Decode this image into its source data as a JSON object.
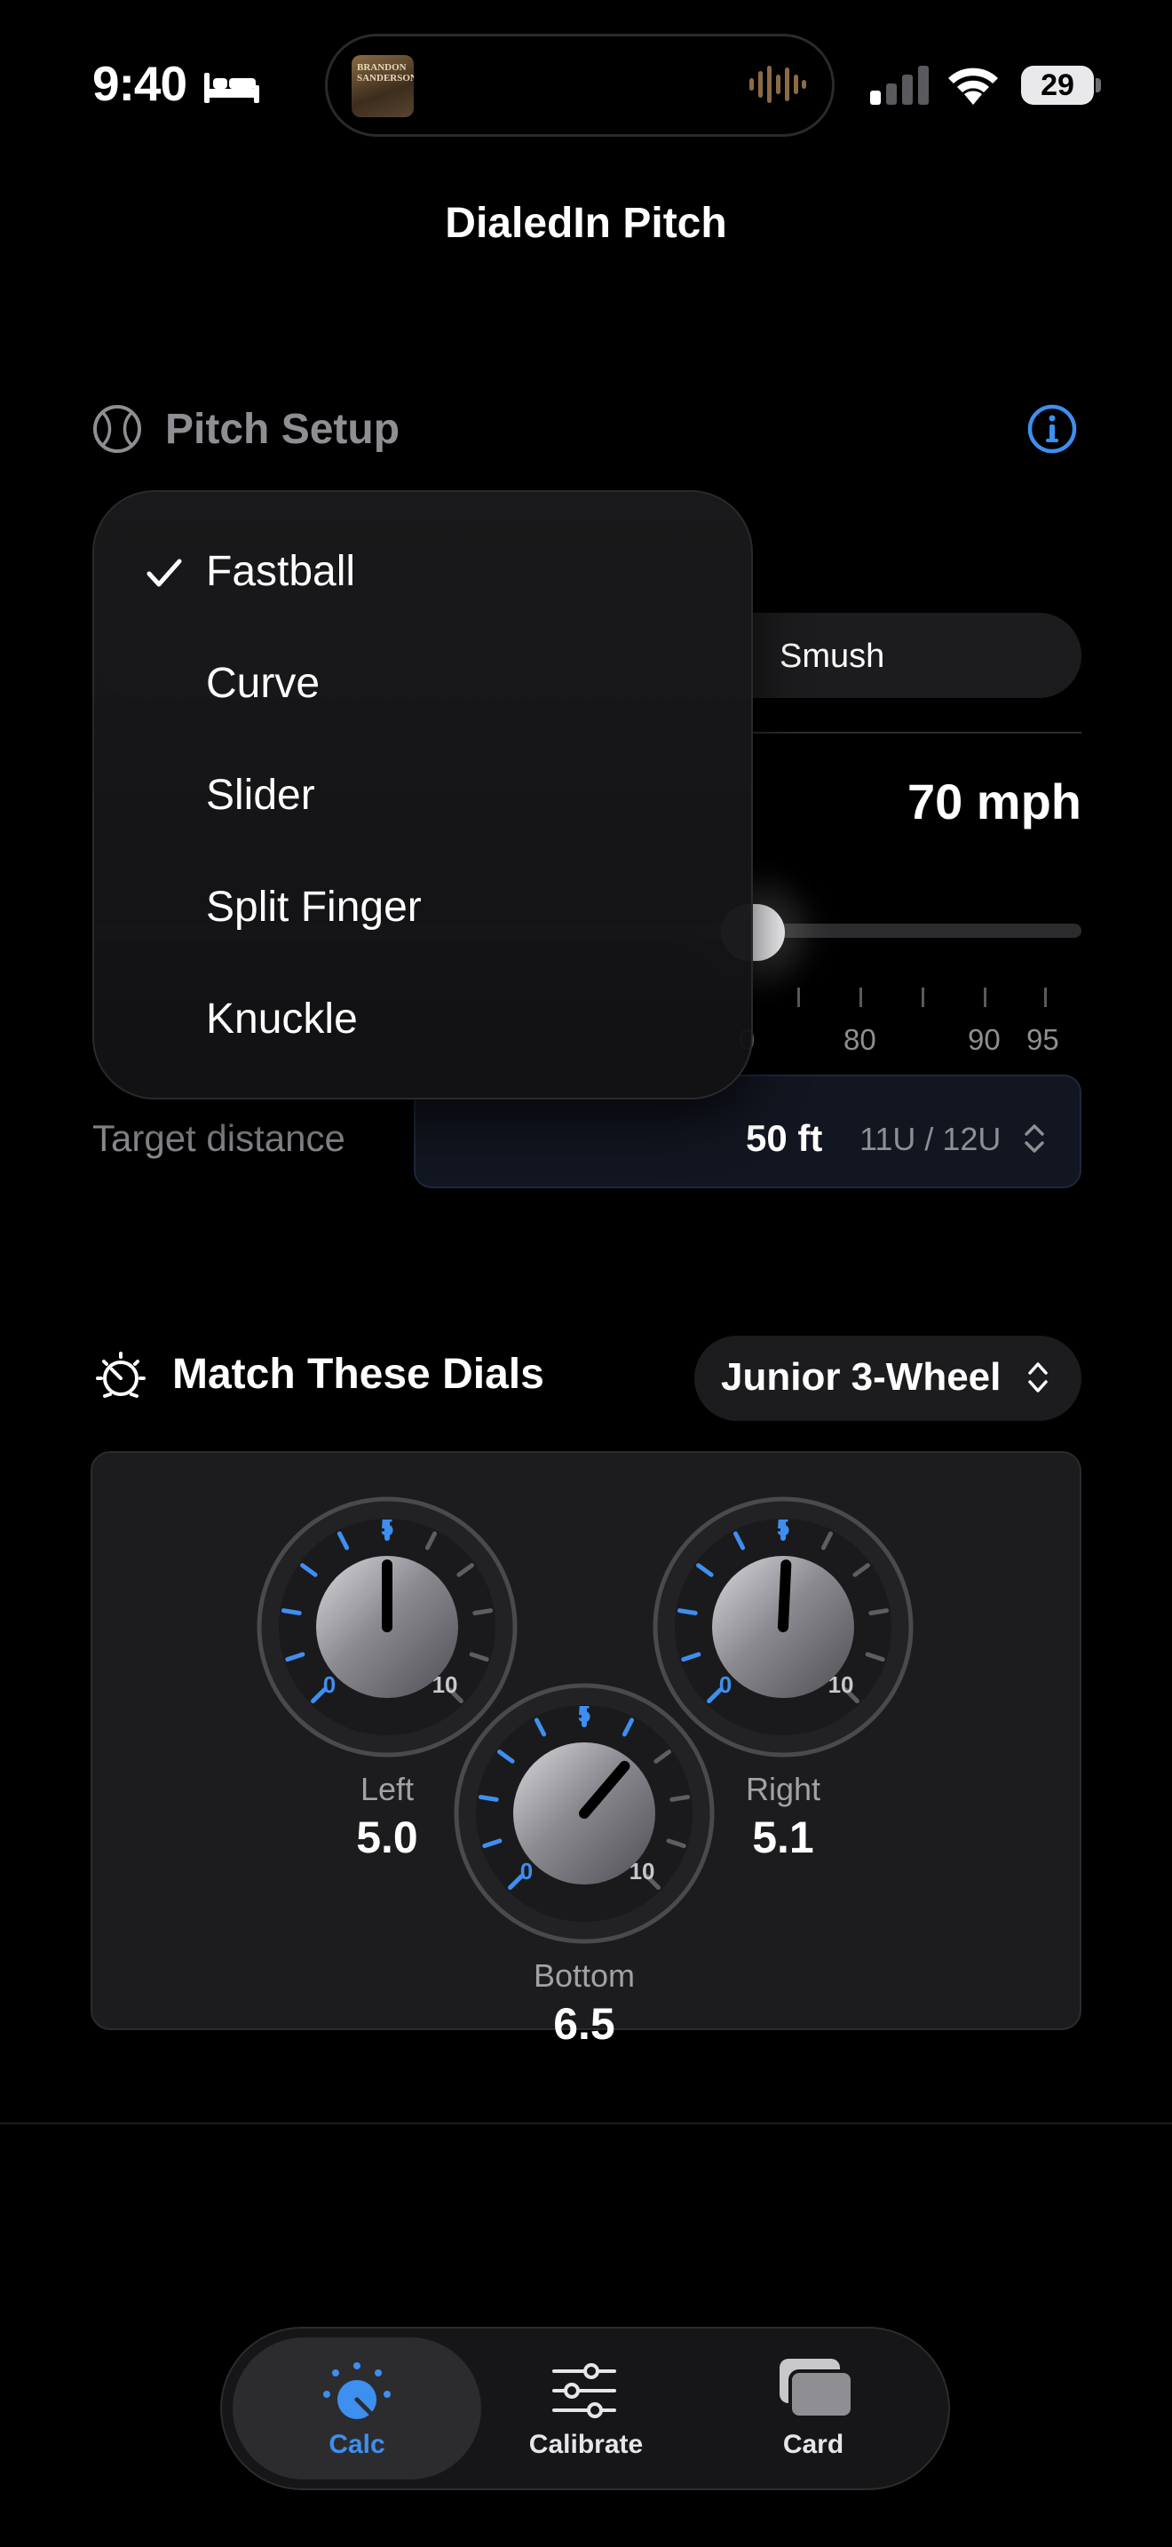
{
  "status_bar": {
    "time": "9:40",
    "battery": "29",
    "album_art_text": "BRANDON SANDERSON"
  },
  "app": {
    "title": "DialedIn Pitch"
  },
  "pitch_setup": {
    "title": "Pitch Setup",
    "segment_visible_label": "Smush",
    "speed_value": "70 mph",
    "slider_ticks": [
      "0",
      "80",
      "90",
      "95"
    ],
    "target_distance_label": "Target distance",
    "target_distance_value": "50 ft",
    "target_distance_sub": "11U / 12U"
  },
  "pitch_menu": {
    "selected": "Fastball",
    "items": [
      "Fastball",
      "Curve",
      "Slider",
      "Split Finger",
      "Knuckle"
    ]
  },
  "match_dials": {
    "title": "Match These Dials",
    "machine": "Junior 3-Wheel",
    "dials": [
      {
        "name": "Left",
        "value": "5.0",
        "min_label": "0",
        "mid_label": "5",
        "max_label": "10"
      },
      {
        "name": "Right",
        "value": "5.1",
        "min_label": "0",
        "mid_label": "5",
        "max_label": "10"
      },
      {
        "name": "Bottom",
        "value": "6.5",
        "min_label": "0",
        "mid_label": "5",
        "max_label": "10"
      }
    ]
  },
  "tab_bar": {
    "tabs": [
      {
        "label": "Calc",
        "active": true
      },
      {
        "label": "Calibrate",
        "active": false
      },
      {
        "label": "Card",
        "active": false
      }
    ]
  },
  "colors": {
    "accent": "#3d8ff0",
    "background": "#000000",
    "panel": "#1c1c1e"
  }
}
